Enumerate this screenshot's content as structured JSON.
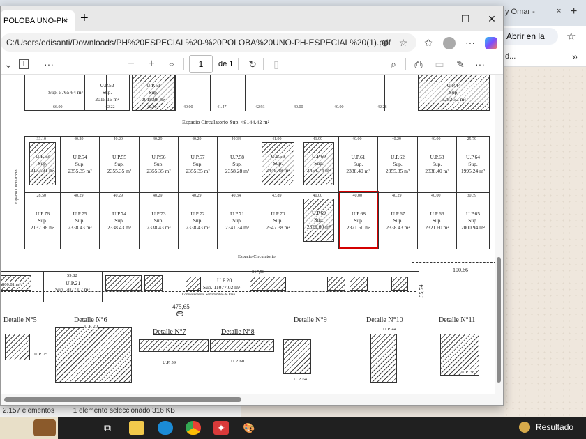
{
  "background_browser": {
    "tab_title": "y Omar -",
    "tab_close": "×",
    "new_tab": "+",
    "open_in_app": "Abrir en la app",
    "star": "☆",
    "bookmark_text": "d...",
    "bookmark_more": "»"
  },
  "explorer_status": {
    "count": "2.157 elementos",
    "selected": "1 elemento seleccionado  316 KB"
  },
  "edge": {
    "tab_title": "POLOBA UNO-PH",
    "tab_close": "×",
    "new_tab": "+",
    "window_controls": {
      "minimize": "–",
      "maximize": "☐",
      "close": "✕"
    },
    "url": "C:/Users/edisanti/Downloads/PH%20ESPECIAL%20-%20POLOBA%20UNO-PH-ESPECIAL%20(1).pdf",
    "toolbar": {
      "page": "1",
      "of": "de 1",
      "zoom_out": "−",
      "zoom_in": "+",
      "more": "···"
    }
  },
  "plan": {
    "sup": "Sup.",
    "top_row": [
      {
        "id": "",
        "area": "Sup. 5765.64 m²"
      },
      {
        "id": "U.P.52",
        "area": "2015.16 m²"
      },
      {
        "id": "U.P.51",
        "area": "2018.98 m²"
      },
      {
        "id": "U.P.44",
        "area": "3282.52 m²"
      }
    ],
    "top_dims": [
      "66.00",
      "42.22",
      "42.30",
      "40.00",
      "41.47",
      "42.93",
      "40.00",
      "40.00",
      "42.28"
    ],
    "circ_main": "Espacio Circulatorio Sup. 49144.42 m²",
    "circ_side": "Espacio Circulatorio",
    "circ_bottom": "Espacio Circulatorio",
    "row1": [
      {
        "id": "U.P.53",
        "area": "2173.91 m²"
      },
      {
        "id": "U.P.54",
        "area": "2355.35 m²"
      },
      {
        "id": "U.P.55",
        "area": "2355.35 m²"
      },
      {
        "id": "U.P.56",
        "area": "2355.35 m²"
      },
      {
        "id": "U.P.57",
        "area": "2355.35 m²"
      },
      {
        "id": "U.P.58",
        "area": "2358.28 m²"
      },
      {
        "id": "U.P.59",
        "area": "2449.48 m²"
      },
      {
        "id": "U.P.60",
        "area": "2454.74 m²"
      },
      {
        "id": "U.P.61",
        "area": "2338.40 m²"
      },
      {
        "id": "U.P.62",
        "area": "2355.35 m²"
      },
      {
        "id": "U.P.63",
        "area": "2338.40 m²"
      },
      {
        "id": "U.P.64",
        "area": "1995.24 m²"
      }
    ],
    "row1_dims": [
      "33.10",
      "40.29",
      "40.29",
      "40.29",
      "40.29",
      "40.34",
      "41.90",
      "41.99",
      "40.00",
      "40.29",
      "40.00",
      "25.79"
    ],
    "row2": [
      {
        "id": "U.P.76",
        "area": "2137.98 m²"
      },
      {
        "id": "U.P.75",
        "area": "2338.43 m²"
      },
      {
        "id": "U.P.74",
        "area": "2338.43 m²"
      },
      {
        "id": "U.P.73",
        "area": "2338.43 m²"
      },
      {
        "id": "U.P.72",
        "area": "2338.43 m²"
      },
      {
        "id": "U.P.71",
        "area": "2341.34 m²"
      },
      {
        "id": "U.P.70",
        "area": "2547.38 m²"
      },
      {
        "id": "U.P.69",
        "area": "2321.60 m²"
      },
      {
        "id": "U.P.68",
        "area": "2321.60 m²"
      },
      {
        "id": "U.P.67",
        "area": "2338.43 m²"
      },
      {
        "id": "U.P.66",
        "area": "2321.60 m²"
      },
      {
        "id": "U.P.65",
        "area": "2000.94 m²"
      }
    ],
    "row2_dims": [
      "28.50",
      "40.29",
      "40.29",
      "40.29",
      "40.29",
      "40.34",
      "43.89",
      "40.00",
      "40.00",
      "40.29",
      "40.00",
      "30.39"
    ],
    "lower": {
      "up21_id": "U.P.21",
      "up21_area": "Sup. 2027.02 m²",
      "up20_id": "U.P.20",
      "up20_area": "Sup. 11077.02 m²",
      "partial_area": "800.81 m²",
      "dim_left": "59,82",
      "dim_mid": "317,56",
      "dim_right": "100,66",
      "dim_side": "35,74",
      "dim_total": "475,65",
      "marker": "lae",
      "curtain": "Cortina Forestal Servidumbre de Paso"
    },
    "details": [
      {
        "title": "Detalle N°5",
        "label": "U.P. 75"
      },
      {
        "title": "Detalle N°6",
        "label": "U.P. 20"
      },
      {
        "title": "Detalle N°7",
        "label": "U.P. 59"
      },
      {
        "title": "Detalle N°8",
        "label": "U.P. 60"
      },
      {
        "title": "Detalle N°9",
        "label": "U.P. 64"
      },
      {
        "title": "Detalle N°10",
        "label": "U.P. 44"
      },
      {
        "title": "Detalle N°11",
        "label": "U.P. 38"
      }
    ]
  },
  "taskbar": {
    "weather": "Resultado"
  }
}
